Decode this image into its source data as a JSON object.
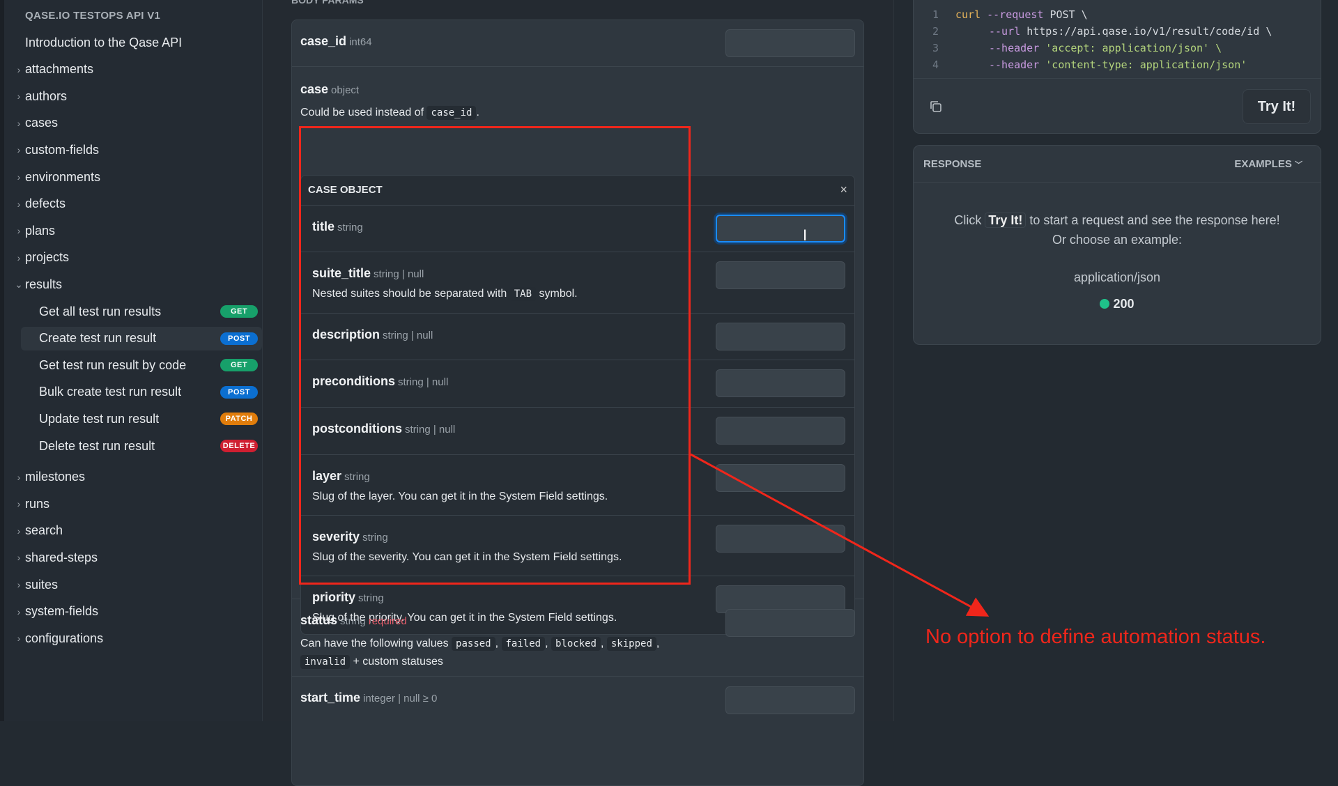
{
  "sidebar": {
    "title": "QASE.IO TESTOPS API V1",
    "intro": "Introduction to the Qase API",
    "groups_top": [
      "attachments",
      "authors",
      "cases",
      "custom-fields",
      "environments",
      "defects",
      "plans",
      "projects"
    ],
    "open_group": "results",
    "results_items": [
      {
        "label": "Get all test run results",
        "method": "GET",
        "color": "#17a06a"
      },
      {
        "label": "Create test run result",
        "method": "POST",
        "color": "#0b6fd1",
        "active": true
      },
      {
        "label": "Get test run result by code",
        "method": "GET",
        "color": "#17a06a"
      },
      {
        "label": "Bulk create test run result",
        "method": "POST",
        "color": "#0b6fd1"
      },
      {
        "label": "Update test run result",
        "method": "PATCH",
        "color": "#e07d0c"
      },
      {
        "label": "Delete test run result",
        "method": "DELETE",
        "color": "#cf1f31"
      }
    ],
    "groups_bottom": [
      "milestones",
      "runs",
      "search",
      "shared-steps",
      "suites",
      "system-fields",
      "configurations"
    ]
  },
  "main": {
    "section_label": "BODY PARAMS",
    "case_id": {
      "name": "case_id",
      "type": "int64"
    },
    "case": {
      "name": "case",
      "type": "object",
      "desc_pre": "Could be used instead of",
      "desc_code": "case_id",
      "desc_post": "."
    },
    "case_object": {
      "title": "CASE OBJECT",
      "close": "×",
      "fields": [
        {
          "name": "title",
          "type": "string"
        },
        {
          "name": "suite_title",
          "type": "string | null",
          "desc_pre": "Nested suites should be separated with",
          "desc_code": "TAB",
          "desc_post": "symbol."
        },
        {
          "name": "description",
          "type": "string | null"
        },
        {
          "name": "preconditions",
          "type": "string | null"
        },
        {
          "name": "postconditions",
          "type": "string | null"
        },
        {
          "name": "layer",
          "type": "string",
          "desc_pre": "Slug of the layer. You can get it in the System Field settings."
        },
        {
          "name": "severity",
          "type": "string",
          "desc_pre": "Slug of the severity. You can get it in the System Field settings."
        },
        {
          "name": "priority",
          "type": "string",
          "desc_pre": "Slug of the priority. You can get it in the System Field settings."
        }
      ]
    },
    "status": {
      "name": "status",
      "type": "string",
      "required": "required",
      "desc": "Can have the following values",
      "values": [
        "passed",
        "failed",
        "blocked",
        "skipped",
        "invalid"
      ],
      "suffix": "+ custom statuses"
    },
    "start_time": {
      "name": "start_time",
      "type": "integer | null ≥ 0"
    }
  },
  "code": {
    "lines": [
      [
        "curl",
        "--request",
        "POST \\"
      ],
      [
        "",
        "--url",
        "https://api.qase.io/v1/result/code/id \\"
      ],
      [
        "",
        "--header",
        "'accept: application/json' \\"
      ],
      [
        "",
        "--header",
        "'content-type: application/json'"
      ]
    ],
    "try_label": "Try It!"
  },
  "response": {
    "label": "RESPONSE",
    "examples": "EXAMPLES",
    "msg_pre": "Click",
    "msg_btn": "Try It!",
    "msg_post": "to start a request and see the response here!",
    "msg2": "Or choose an example:",
    "content_type": "application/json",
    "status_code": "200",
    "status_color": "#1fc28a"
  },
  "annotation": {
    "text": "No option to define automation status.",
    "color": "#f0261b"
  }
}
